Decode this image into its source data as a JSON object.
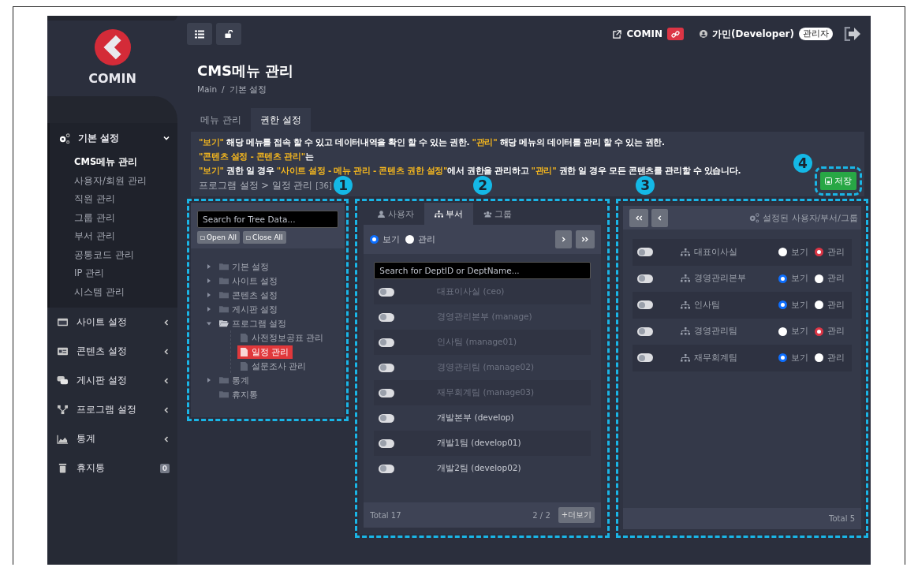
{
  "sidebar": {
    "logo": "COMIN",
    "menu": [
      {
        "label": "기본 설정",
        "expanded": true,
        "children": [
          {
            "label": "CMS메뉴 관리",
            "selected": true
          },
          {
            "label": "사용자/회원 관리",
            "selected": false
          },
          {
            "label": "직원 관리",
            "selected": false
          },
          {
            "label": "그룹 관리",
            "selected": false
          },
          {
            "label": "부서 관리",
            "selected": false
          },
          {
            "label": "공통코드 관리",
            "selected": false
          },
          {
            "label": "IP 관리",
            "selected": false
          },
          {
            "label": "시스템 관리",
            "selected": false
          }
        ]
      },
      {
        "label": "사이트 설정",
        "expanded": false
      },
      {
        "label": "콘텐츠 설정",
        "expanded": false
      },
      {
        "label": "게시판 설정",
        "expanded": false
      },
      {
        "label": "프로그램 설정",
        "expanded": false
      },
      {
        "label": "통계",
        "expanded": false
      },
      {
        "label": "휴지통",
        "count": "0"
      }
    ]
  },
  "header": {
    "site": "COMIN",
    "user": "가민(Developer)",
    "role": "관리자"
  },
  "page": {
    "title": "CMS메뉴 관리",
    "breadcrumb": [
      "Main",
      "기본 설정"
    ],
    "breadcrumb_separator": "/"
  },
  "tabs": [
    {
      "label": "메뉴 관리",
      "selected": false
    },
    {
      "label": "권한 설정",
      "selected": true
    }
  ],
  "info": {
    "lines": [
      "**\"보기\"** 해당 메뉴를 접속 할 수 있고 데이터내역을 확인 할 수 있는 권한. **\"관리\"** 해당 메뉴의 데이터를 관리 할 수 있는 권한.",
      "**\"콘텐츠 설정 - 콘텐츠 관리\"**는",
      "**\"보기\"** 권한 일 경우 **\"사이트 설정 - 메뉴 관리 - 콘텐츠 권한 설정\"**에서 권한을 관리하고 **\"관리\"** 권한 일 경우 모든 콘텐츠를 관리할 수 있습니다."
    ],
    "path": "프로그램 설정 > 일정 관리",
    "count": "[36]"
  },
  "save_button": "저장",
  "markers": [
    "1",
    "2",
    "3",
    "4"
  ],
  "tree_panel": {
    "search_placeholder": "Search for Tree Data...",
    "buttons": [
      "Open All",
      "Close All"
    ],
    "nodes": [
      {
        "label": "기본 설정",
        "kind": "folder",
        "expanded": false
      },
      {
        "label": "사이트 설정",
        "kind": "folder",
        "expanded": false
      },
      {
        "label": "콘텐츠 설정",
        "kind": "folder",
        "expanded": false
      },
      {
        "label": "게시판 설정",
        "kind": "folder",
        "expanded": false
      },
      {
        "label": "프로그램 설정",
        "kind": "folder",
        "expanded": true,
        "children": [
          {
            "label": "사전정보공표 관리",
            "kind": "file",
            "selected": false
          },
          {
            "label": "일정 관리",
            "kind": "file",
            "selected": true
          },
          {
            "label": "설문조사 관리",
            "kind": "file",
            "selected": false
          }
        ]
      },
      {
        "label": "통계",
        "kind": "folder",
        "expanded": false
      },
      {
        "label": "휴지통",
        "kind": "folder"
      }
    ]
  },
  "dept_panel": {
    "tabs": [
      {
        "label": "사용자",
        "selected": false
      },
      {
        "label": "부서",
        "selected": true
      },
      {
        "label": "그룹",
        "selected": false
      }
    ],
    "radios": [
      {
        "label": "보기",
        "selected": true
      },
      {
        "label": "관리",
        "selected": false
      }
    ],
    "search_placeholder": "Search for DeptID or DeptName...",
    "rows": [
      {
        "label": "대표이사실 (ceo)",
        "on": false,
        "disabled": true
      },
      {
        "label": "경영관리본부 (manage)",
        "on": false,
        "disabled": true
      },
      {
        "label": "인사팀 (manage01)",
        "on": false,
        "disabled": true
      },
      {
        "label": "경영관리팀 (manage02)",
        "on": false,
        "disabled": true
      },
      {
        "label": "재무회계팀 (manage03)",
        "on": false,
        "disabled": true
      },
      {
        "label": "개발본부 (develop)",
        "on": false,
        "disabled": false
      },
      {
        "label": "개발1팀 (develop01)",
        "on": false,
        "disabled": false
      },
      {
        "label": "개발2팀 (develop02)",
        "on": false,
        "disabled": false
      }
    ],
    "total": "Total 17",
    "page": "2 / 2",
    "more": "+더보기"
  },
  "assigned_panel": {
    "title": "설정된 사용자/부서/그룹",
    "rows": [
      {
        "label": "대표이사실",
        "on": false,
        "options": [
          {
            "label": "보기",
            "selected": false
          },
          {
            "label": "관리",
            "selected": true
          }
        ]
      },
      {
        "label": "경영관리본부",
        "on": false,
        "options": [
          {
            "label": "보기",
            "selected": true
          },
          {
            "label": "관리",
            "selected": false
          }
        ]
      },
      {
        "label": "인사팀",
        "on": false,
        "options": [
          {
            "label": "보기",
            "selected": true
          },
          {
            "label": "관리",
            "selected": false
          }
        ]
      },
      {
        "label": "경영관리팀",
        "on": false,
        "options": [
          {
            "label": "보기",
            "selected": false
          },
          {
            "label": "관리",
            "selected": true
          }
        ]
      },
      {
        "label": "재무회계팀",
        "on": false,
        "options": [
          {
            "label": "보기",
            "selected": true
          },
          {
            "label": "관리",
            "selected": false
          }
        ]
      }
    ],
    "total": "Total 5"
  }
}
